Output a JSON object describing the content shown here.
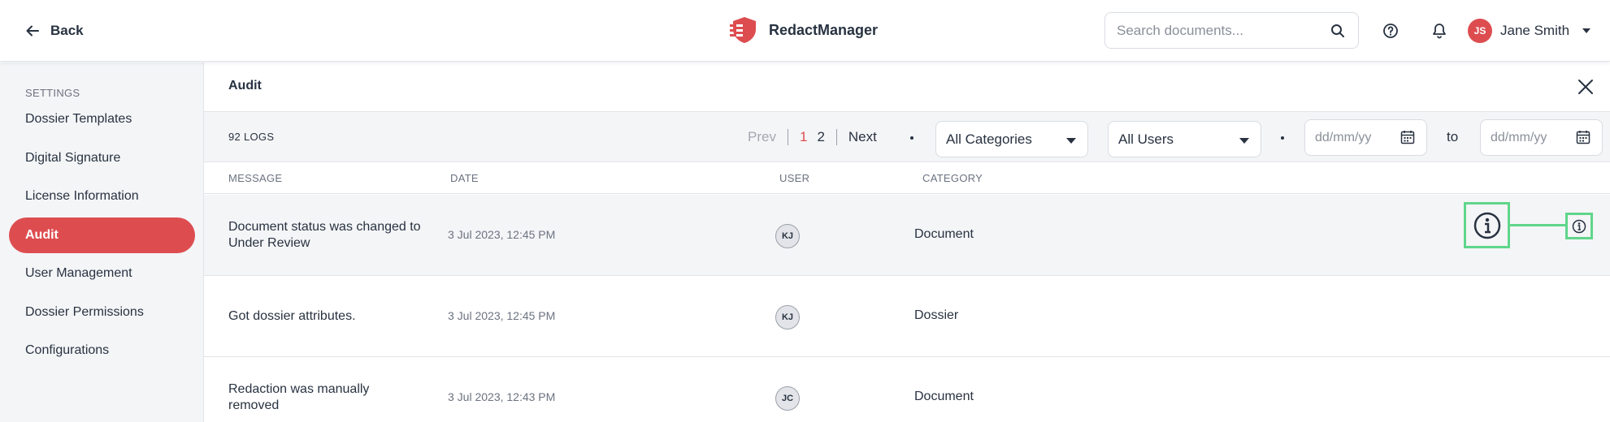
{
  "header": {
    "back_label": "Back",
    "brand_name": "RedactManager",
    "search": {
      "placeholder": "Search documents..."
    },
    "user": {
      "initials": "JS",
      "name": "Jane Smith"
    },
    "brand_color": "#dd4d50"
  },
  "sidebar": {
    "section_label": "SETTINGS",
    "items": [
      {
        "label": "Dossier Templates",
        "active": false
      },
      {
        "label": "Digital Signature",
        "active": false
      },
      {
        "label": "License Information",
        "active": false
      },
      {
        "label": "Audit",
        "active": true
      },
      {
        "label": "User Management",
        "active": false
      },
      {
        "label": "Dossier Permissions",
        "active": false
      },
      {
        "label": "Configurations",
        "active": false
      }
    ]
  },
  "main": {
    "title": "Audit",
    "logs_count": "92 LOGS",
    "pager": {
      "prev": "Prev",
      "pages": [
        "1",
        "2"
      ],
      "current": "1",
      "next": "Next"
    },
    "filters": {
      "category": "All Categories",
      "user": "All Users",
      "date_from_placeholder": "dd/mm/yy",
      "to_label": "to",
      "date_to_placeholder": "dd/mm/yy"
    },
    "columns": [
      "MESSAGE",
      "DATE",
      "USER",
      "CATEGORY"
    ],
    "rows": [
      {
        "message": "Document status was changed to Under Review",
        "date": "3 Jul 2023, 12:45 PM",
        "user": "KJ",
        "category": "Document"
      },
      {
        "message": "Got dossier attributes.",
        "date": "3 Jul 2023, 12:45 PM",
        "user": "KJ",
        "category": "Dossier"
      },
      {
        "message": "Redaction was manually removed",
        "date": "3 Jul 2023, 12:43 PM",
        "user": "JC",
        "category": "Document"
      }
    ],
    "highlight_color": "#5fd68a"
  }
}
